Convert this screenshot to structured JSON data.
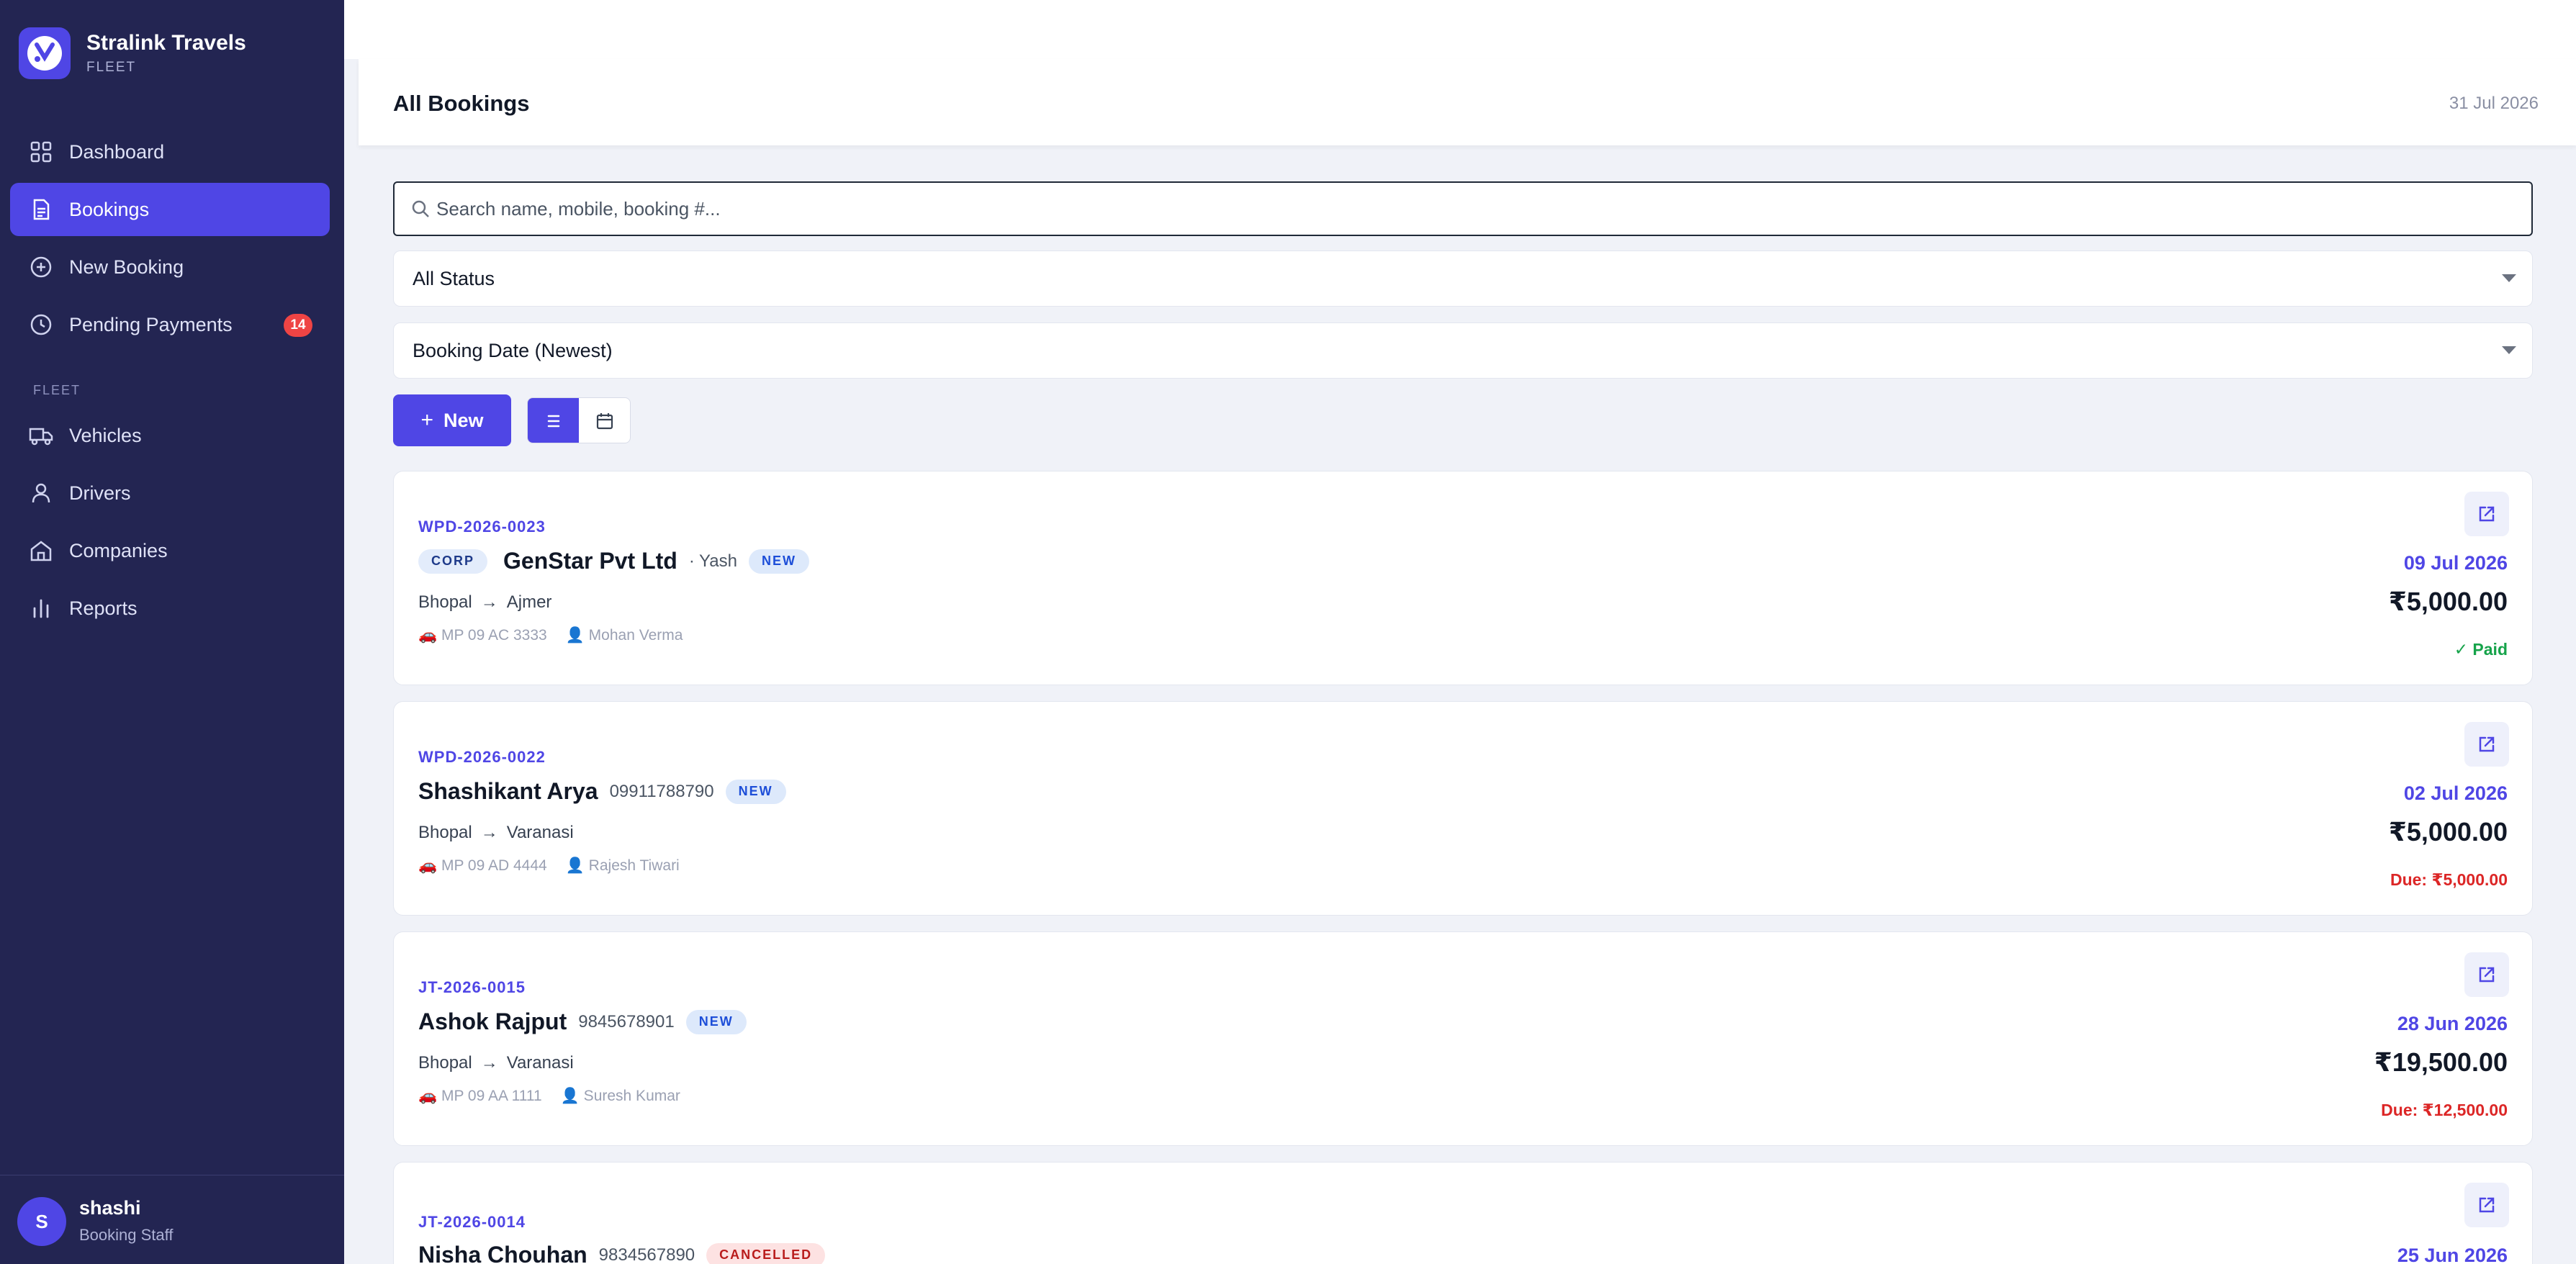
{
  "brand": {
    "name": "Stralink Travels",
    "subtitle": "FLEET"
  },
  "nav": {
    "items": [
      {
        "label": "Dashboard",
        "icon": "grid-icon"
      },
      {
        "label": "Bookings",
        "icon": "document-icon",
        "active": true
      },
      {
        "label": "New Booking",
        "icon": "plus-circle-icon"
      },
      {
        "label": "Pending Payments",
        "icon": "clock-icon",
        "badge": "14"
      }
    ],
    "section_label": "FLEET",
    "fleet_items": [
      {
        "label": "Vehicles",
        "icon": "truck-icon"
      },
      {
        "label": "Drivers",
        "icon": "user-icon"
      },
      {
        "label": "Companies",
        "icon": "building-icon"
      },
      {
        "label": "Reports",
        "icon": "bar-chart-icon"
      }
    ]
  },
  "user": {
    "initial": "S",
    "name": "shashi",
    "role": "Booking Staff"
  },
  "header": {
    "title": "All Bookings",
    "date": "31 Jul 2026"
  },
  "search": {
    "placeholder": "Search name, mobile, booking #..."
  },
  "filters": {
    "status": "All Status",
    "sort": "Booking Date (Newest)"
  },
  "toolbar": {
    "new_label": "New"
  },
  "bookings": [
    {
      "id": "WPD-2026-0023",
      "corp_tag": "CORP",
      "name": "GenStar Pvt Ltd",
      "sub": "· Yash",
      "status": "NEW",
      "from": "Bhopal",
      "to": "Ajmer",
      "vehicle": "🚗 MP 09 AC 3333",
      "driver": "👤 Mohan Verma",
      "date": "09 Jul 2026",
      "amount": "₹5,000.00",
      "payment": "✓ Paid"
    },
    {
      "id": "WPD-2026-0022",
      "name": "Shashikant Arya",
      "sub": "09911788790",
      "status": "NEW",
      "from": "Bhopal",
      "to": "Varanasi",
      "vehicle": "🚗 MP 09 AD 4444",
      "driver": "👤 Rajesh Tiwari",
      "date": "02 Jul 2026",
      "amount": "₹5,000.00",
      "payment": "Due: ₹5,000.00"
    },
    {
      "id": "JT-2026-0015",
      "name": "Ashok Rajput",
      "sub": "9845678901",
      "status": "NEW",
      "from": "Bhopal",
      "to": "Varanasi",
      "vehicle": "🚗 MP 09 AA 1111",
      "driver": "👤 Suresh Kumar",
      "date": "28 Jun 2026",
      "amount": "₹19,500.00",
      "payment": "Due: ₹12,500.00"
    },
    {
      "id": "JT-2026-0014",
      "name": "Nisha Chouhan",
      "sub": "9834567890",
      "status": "CANCELLED",
      "date": "25 Jun 2026"
    }
  ],
  "colors": {
    "accent": "#4f46e5",
    "sidebar": "#232552",
    "paid": "#16a34a",
    "due": "#dc2626"
  }
}
